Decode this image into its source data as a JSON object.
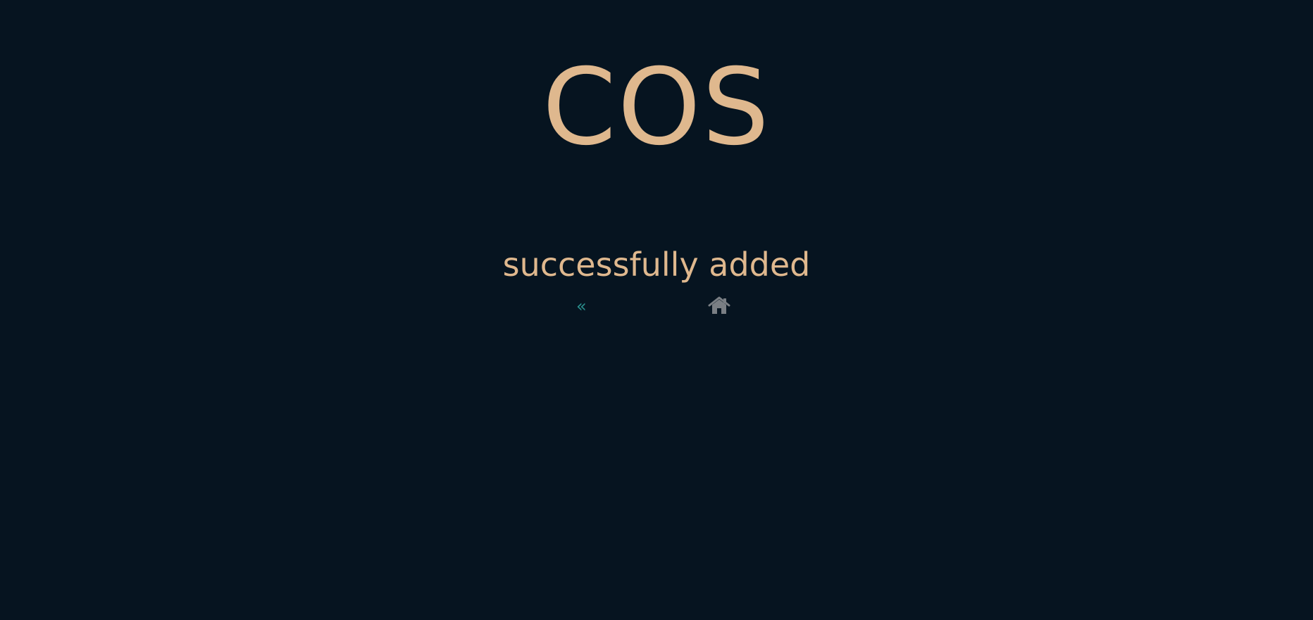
{
  "header": {
    "logo_text": "COS"
  },
  "main": {
    "message": "successfully added",
    "back_link_text": "«",
    "home_icon": "home-icon"
  },
  "colors": {
    "background": "#061420",
    "text": "#dfb88e",
    "back_link": "#2a8f8d",
    "home_icon": "#7a7f84"
  }
}
